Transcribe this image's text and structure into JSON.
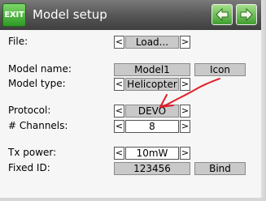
{
  "header": {
    "exit_label": "EXIT",
    "title": "Model setup",
    "prev_icon": "arrow-left-icon",
    "next_icon": "arrow-right-icon",
    "accent_color": "#3f9e2e"
  },
  "rows": {
    "file": {
      "label": "File:",
      "value": "Load..."
    },
    "model_name": {
      "label": "Model name:",
      "value": "Model1",
      "button": "Icon"
    },
    "model_type": {
      "label": "Model type:",
      "value": "Helicopter"
    },
    "protocol": {
      "label": "Protocol:",
      "value": "DEVO"
    },
    "channels": {
      "label": "# Channels:",
      "value": "8"
    },
    "tx_power": {
      "label": "Tx power:",
      "value": "10mW"
    },
    "fixed_id": {
      "label": "Fixed ID:",
      "value": "123456",
      "button": "Bind"
    }
  },
  "stepper": {
    "left": "<",
    "right": ">"
  },
  "annotation": {
    "color": "#e0202a"
  }
}
